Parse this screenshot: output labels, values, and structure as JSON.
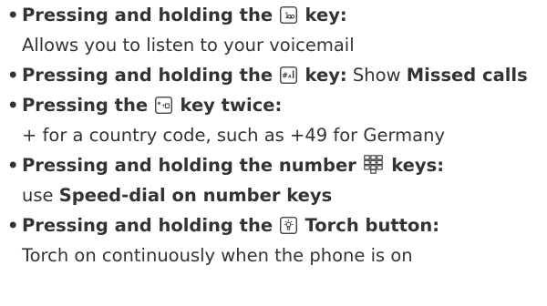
{
  "items": [
    {
      "bullet": "•",
      "head_before": "Pressing and holding the",
      "key_icon": "key-1-voicemail-icon",
      "head_after": "key:",
      "detail": "Allows you to listen to your voicemail"
    },
    {
      "bullet": "•",
      "head_before": "Pressing and holding the",
      "key_icon": "key-hash-icon",
      "head_after": "key:",
      "detail_normal": "Show",
      "detail_bold": "Missed calls"
    },
    {
      "bullet": "•",
      "head_before": "Pressing the",
      "key_icon": "key-star-icon",
      "head_after": "key twice:",
      "detail": "+ for a country code, such as +49 for Germany"
    },
    {
      "bullet": "•",
      "head_before": "Pressing and holding the number",
      "key_icon": "number-keypad-grid-icon",
      "head_after": "keys:",
      "detail_normal": "use",
      "detail_bold": "Speed-dial on number keys"
    },
    {
      "bullet": "•",
      "head_before": "Pressing and holding the",
      "key_icon": "torch-button-icon",
      "head_after": "Torch button:",
      "detail": "Torch on continuously when the phone is on"
    }
  ]
}
